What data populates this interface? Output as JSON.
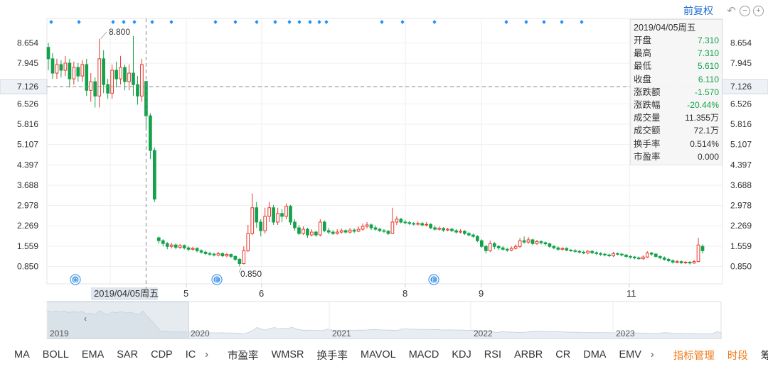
{
  "header": {
    "restore_right_label": "前复权"
  },
  "info_panel": {
    "date": "2019/04/05周五",
    "rows": [
      {
        "key": "开盘",
        "value": "7.310",
        "color": "green"
      },
      {
        "key": "最高",
        "value": "7.310",
        "color": "green"
      },
      {
        "key": "最低",
        "value": "5.610",
        "color": "green"
      },
      {
        "key": "收盘",
        "value": "6.110",
        "color": "green"
      },
      {
        "key": "涨跌额",
        "value": "-1.570",
        "color": "green"
      },
      {
        "key": "涨跌幅",
        "value": "-20.44%",
        "color": "green"
      },
      {
        "key": "成交量",
        "value": "11.355万",
        "color": "normal"
      },
      {
        "key": "成交额",
        "value": "72.1万",
        "color": "normal"
      },
      {
        "key": "换手率",
        "value": "0.514%",
        "color": "normal"
      },
      {
        "key": "市盈率",
        "value": "0.000",
        "color": "normal"
      }
    ]
  },
  "tabs": {
    "left": [
      "MA",
      "BOLL",
      "EMA",
      "SAR",
      "CDP",
      "IC"
    ],
    "right": [
      "市盈率",
      "WMSR",
      "换手率",
      "MAVOL",
      "MACD",
      "KDJ",
      "RSI",
      "ARBR",
      "CR",
      "DMA",
      "EMV"
    ],
    "manage_label": "指标管理",
    "timeshare_label": "时段",
    "chips_label": "筹码"
  },
  "colors": {
    "up": "#e8372c",
    "down": "#13a24b",
    "event_marker": "#1e90ff",
    "crosshair": "#888888"
  },
  "chart_data": {
    "type": "candlestick",
    "y_ticks": [
      "8.654",
      "7.945",
      "7.126",
      "6.526",
      "5.816",
      "5.107",
      "4.397",
      "3.688",
      "2.978",
      "2.269",
      "1.559",
      "0.850"
    ],
    "crosshair_value": "7.126",
    "x_tick_labels": [
      "5",
      "6",
      "8",
      "9",
      "11"
    ],
    "crosshair_date": "2019/04/05周五",
    "annotations": {
      "max_label": "8.800",
      "min_label": "0.850"
    },
    "event_badges": [
      "Q",
      "E",
      "E"
    ],
    "navigator_years": [
      "2019",
      "2020",
      "2021",
      "2022",
      "2023"
    ],
    "ylim": [
      0.85,
      8.654
    ],
    "series": [
      {
        "o": 8.5,
        "c": 8.1,
        "h": 8.654,
        "l": 7.7
      },
      {
        "o": 8.1,
        "c": 7.6,
        "h": 8.3,
        "l": 7.4
      },
      {
        "o": 7.6,
        "c": 7.9,
        "h": 8.1,
        "l": 7.4
      },
      {
        "o": 7.9,
        "c": 7.7,
        "h": 8.05,
        "l": 7.45
      },
      {
        "o": 7.7,
        "c": 7.95,
        "h": 8.2,
        "l": 7.5
      },
      {
        "o": 7.95,
        "c": 7.4,
        "h": 8.1,
        "l": 7.1
      },
      {
        "o": 7.4,
        "c": 7.8,
        "h": 8.0,
        "l": 7.2
      },
      {
        "o": 7.8,
        "c": 7.5,
        "h": 7.95,
        "l": 7.3
      },
      {
        "o": 7.5,
        "c": 7.9,
        "h": 8.05,
        "l": 7.3
      },
      {
        "o": 7.9,
        "c": 7.0,
        "h": 8.1,
        "l": 6.8
      },
      {
        "o": 7.0,
        "c": 7.3,
        "h": 7.6,
        "l": 6.6
      },
      {
        "o": 7.3,
        "c": 6.8,
        "h": 7.45,
        "l": 6.4
      },
      {
        "o": 6.8,
        "c": 8.1,
        "h": 8.8,
        "l": 6.4
      },
      {
        "o": 8.1,
        "c": 7.2,
        "h": 8.4,
        "l": 6.9
      },
      {
        "o": 7.2,
        "c": 6.9,
        "h": 7.4,
        "l": 6.7
      },
      {
        "o": 6.9,
        "c": 7.7,
        "h": 7.9,
        "l": 6.7
      },
      {
        "o": 7.7,
        "c": 7.4,
        "h": 8.0,
        "l": 7.1
      },
      {
        "o": 7.4,
        "c": 7.8,
        "h": 8.2,
        "l": 7.2
      },
      {
        "o": 7.8,
        "c": 7.3,
        "h": 7.9,
        "l": 7.0
      },
      {
        "o": 7.3,
        "c": 7.6,
        "h": 7.9,
        "l": 7.0
      },
      {
        "o": 7.6,
        "c": 7.2,
        "h": 8.9,
        "l": 6.8
      },
      {
        "o": 7.2,
        "c": 6.8,
        "h": 7.5,
        "l": 6.5
      },
      {
        "o": 6.8,
        "c": 7.9,
        "h": 8.1,
        "l": 6.6
      },
      {
        "o": 7.31,
        "c": 6.11,
        "h": 7.31,
        "l": 5.61
      },
      {
        "o": 6.11,
        "c": 4.9,
        "h": 6.2,
        "l": 4.6
      },
      {
        "o": 4.9,
        "c": 3.2,
        "h": 5.0,
        "l": 3.1
      },
      {
        "o": 1.85,
        "c": 1.75,
        "h": 1.9,
        "l": 1.65
      },
      {
        "o": 1.75,
        "c": 1.65,
        "h": 1.8,
        "l": 1.55
      },
      {
        "o": 1.65,
        "c": 1.55,
        "h": 1.7,
        "l": 1.45
      },
      {
        "o": 1.55,
        "c": 1.6,
        "h": 1.68,
        "l": 1.48
      },
      {
        "o": 1.6,
        "c": 1.52,
        "h": 1.66,
        "l": 1.45
      },
      {
        "o": 1.52,
        "c": 1.58,
        "h": 1.64,
        "l": 1.46
      },
      {
        "o": 1.58,
        "c": 1.5,
        "h": 1.62,
        "l": 1.44
      },
      {
        "o": 1.5,
        "c": 1.45,
        "h": 1.56,
        "l": 1.38
      },
      {
        "o": 1.45,
        "c": 1.48,
        "h": 1.54,
        "l": 1.4
      },
      {
        "o": 1.48,
        "c": 1.4,
        "h": 1.52,
        "l": 1.34
      },
      {
        "o": 1.4,
        "c": 1.35,
        "h": 1.45,
        "l": 1.3
      },
      {
        "o": 1.35,
        "c": 1.3,
        "h": 1.4,
        "l": 1.25
      },
      {
        "o": 1.3,
        "c": 1.28,
        "h": 1.36,
        "l": 1.22
      },
      {
        "o": 1.28,
        "c": 1.25,
        "h": 1.33,
        "l": 1.2
      },
      {
        "o": 1.25,
        "c": 1.3,
        "h": 1.36,
        "l": 1.2
      },
      {
        "o": 1.3,
        "c": 1.22,
        "h": 1.34,
        "l": 1.18
      },
      {
        "o": 1.22,
        "c": 1.27,
        "h": 1.32,
        "l": 1.17
      },
      {
        "o": 1.27,
        "c": 1.2,
        "h": 1.3,
        "l": 1.14
      },
      {
        "o": 1.2,
        "c": 1.1,
        "h": 1.24,
        "l": 1.04
      },
      {
        "o": 1.1,
        "c": 0.95,
        "h": 1.14,
        "l": 0.85
      },
      {
        "o": 0.95,
        "c": 1.4,
        "h": 1.55,
        "l": 0.92
      },
      {
        "o": 1.4,
        "c": 2.0,
        "h": 2.3,
        "l": 1.35
      },
      {
        "o": 2.0,
        "c": 2.9,
        "h": 3.4,
        "l": 1.95
      },
      {
        "o": 2.9,
        "c": 2.4,
        "h": 3.1,
        "l": 2.2
      },
      {
        "o": 2.4,
        "c": 2.1,
        "h": 2.5,
        "l": 1.9
      },
      {
        "o": 2.1,
        "c": 2.6,
        "h": 2.9,
        "l": 2.0
      },
      {
        "o": 2.6,
        "c": 2.9,
        "h": 3.1,
        "l": 2.4
      },
      {
        "o": 2.9,
        "c": 2.4,
        "h": 3.0,
        "l": 2.3
      },
      {
        "o": 2.4,
        "c": 2.7,
        "h": 2.9,
        "l": 2.3
      },
      {
        "o": 2.7,
        "c": 2.6,
        "h": 2.85,
        "l": 2.4
      },
      {
        "o": 2.6,
        "c": 2.95,
        "h": 3.05,
        "l": 2.5
      },
      {
        "o": 2.95,
        "c": 2.4,
        "h": 3.0,
        "l": 2.3
      },
      {
        "o": 2.4,
        "c": 2.2,
        "h": 2.5,
        "l": 2.1
      },
      {
        "o": 2.2,
        "c": 2.0,
        "h": 2.3,
        "l": 1.95
      },
      {
        "o": 2.0,
        "c": 2.15,
        "h": 2.25,
        "l": 1.95
      },
      {
        "o": 2.15,
        "c": 1.95,
        "h": 2.2,
        "l": 1.85
      },
      {
        "o": 1.95,
        "c": 2.05,
        "h": 2.15,
        "l": 1.9
      },
      {
        "o": 2.05,
        "c": 1.95,
        "h": 2.1,
        "l": 1.88
      },
      {
        "o": 1.95,
        "c": 2.4,
        "h": 2.5,
        "l": 1.9
      },
      {
        "o": 2.4,
        "c": 2.1,
        "h": 2.45,
        "l": 2.05
      },
      {
        "o": 2.1,
        "c": 2.05,
        "h": 2.2,
        "l": 1.98
      },
      {
        "o": 2.05,
        "c": 2.0,
        "h": 2.12,
        "l": 1.95
      },
      {
        "o": 2.0,
        "c": 2.05,
        "h": 2.15,
        "l": 1.96
      },
      {
        "o": 2.05,
        "c": 2.1,
        "h": 2.18,
        "l": 2.0
      },
      {
        "o": 2.1,
        "c": 2.05,
        "h": 2.15,
        "l": 2.0
      },
      {
        "o": 2.05,
        "c": 2.12,
        "h": 2.2,
        "l": 2.0
      },
      {
        "o": 2.12,
        "c": 2.08,
        "h": 2.18,
        "l": 2.02
      },
      {
        "o": 2.08,
        "c": 2.15,
        "h": 2.25,
        "l": 2.05
      },
      {
        "o": 2.15,
        "c": 2.25,
        "h": 2.35,
        "l": 2.1
      },
      {
        "o": 2.25,
        "c": 2.3,
        "h": 2.4,
        "l": 2.18
      },
      {
        "o": 2.3,
        "c": 2.2,
        "h": 2.35,
        "l": 2.12
      },
      {
        "o": 2.2,
        "c": 2.15,
        "h": 2.28,
        "l": 2.1
      },
      {
        "o": 2.15,
        "c": 2.1,
        "h": 2.2,
        "l": 2.05
      },
      {
        "o": 2.1,
        "c": 2.08,
        "h": 2.15,
        "l": 2.02
      },
      {
        "o": 2.08,
        "c": 2.0,
        "h": 2.12,
        "l": 1.95
      },
      {
        "o": 2.0,
        "c": 2.4,
        "h": 2.9,
        "l": 1.98
      },
      {
        "o": 2.4,
        "c": 2.5,
        "h": 2.6,
        "l": 2.3
      },
      {
        "o": 2.5,
        "c": 2.4,
        "h": 2.55,
        "l": 2.35
      },
      {
        "o": 2.4,
        "c": 2.38,
        "h": 2.48,
        "l": 2.32
      },
      {
        "o": 2.38,
        "c": 2.35,
        "h": 2.44,
        "l": 2.3
      },
      {
        "o": 2.35,
        "c": 2.33,
        "h": 2.4,
        "l": 2.28
      },
      {
        "o": 2.33,
        "c": 2.35,
        "h": 2.42,
        "l": 2.28
      },
      {
        "o": 2.35,
        "c": 2.3,
        "h": 2.4,
        "l": 2.25
      },
      {
        "o": 2.3,
        "c": 2.32,
        "h": 2.4,
        "l": 2.25
      },
      {
        "o": 2.32,
        "c": 2.2,
        "h": 2.36,
        "l": 2.15
      },
      {
        "o": 2.2,
        "c": 2.15,
        "h": 2.28,
        "l": 2.1
      },
      {
        "o": 2.15,
        "c": 2.18,
        "h": 2.25,
        "l": 2.1
      },
      {
        "o": 2.18,
        "c": 2.12,
        "h": 2.22,
        "l": 2.06
      },
      {
        "o": 2.12,
        "c": 2.15,
        "h": 2.2,
        "l": 2.08
      },
      {
        "o": 2.15,
        "c": 2.1,
        "h": 2.2,
        "l": 2.05
      },
      {
        "o": 2.1,
        "c": 2.05,
        "h": 2.15,
        "l": 2.0
      },
      {
        "o": 2.05,
        "c": 2.08,
        "h": 2.15,
        "l": 2.0
      },
      {
        "o": 2.08,
        "c": 2.0,
        "h": 2.12,
        "l": 1.95
      },
      {
        "o": 2.0,
        "c": 1.95,
        "h": 2.05,
        "l": 1.9
      },
      {
        "o": 1.95,
        "c": 1.9,
        "h": 2.0,
        "l": 1.85
      },
      {
        "o": 1.9,
        "c": 1.75,
        "h": 1.94,
        "l": 1.7
      },
      {
        "o": 1.75,
        "c": 1.55,
        "h": 1.8,
        "l": 1.5
      },
      {
        "o": 1.55,
        "c": 1.4,
        "h": 1.6,
        "l": 1.3
      },
      {
        "o": 1.4,
        "c": 1.65,
        "h": 1.75,
        "l": 1.35
      },
      {
        "o": 1.65,
        "c": 1.55,
        "h": 1.7,
        "l": 1.45
      },
      {
        "o": 1.55,
        "c": 1.5,
        "h": 1.6,
        "l": 1.42
      },
      {
        "o": 1.5,
        "c": 1.45,
        "h": 1.56,
        "l": 1.4
      },
      {
        "o": 1.45,
        "c": 1.42,
        "h": 1.5,
        "l": 1.36
      },
      {
        "o": 1.42,
        "c": 1.48,
        "h": 1.55,
        "l": 1.38
      },
      {
        "o": 1.48,
        "c": 1.55,
        "h": 1.62,
        "l": 1.44
      },
      {
        "o": 1.55,
        "c": 1.75,
        "h": 1.85,
        "l": 1.5
      },
      {
        "o": 1.75,
        "c": 1.7,
        "h": 1.9,
        "l": 1.65
      },
      {
        "o": 1.7,
        "c": 1.78,
        "h": 1.88,
        "l": 1.64
      },
      {
        "o": 1.78,
        "c": 1.65,
        "h": 1.82,
        "l": 1.6
      },
      {
        "o": 1.65,
        "c": 1.72,
        "h": 1.78,
        "l": 1.6
      },
      {
        "o": 1.72,
        "c": 1.68,
        "h": 1.76,
        "l": 1.62
      },
      {
        "o": 1.68,
        "c": 1.64,
        "h": 1.72,
        "l": 1.58
      },
      {
        "o": 1.64,
        "c": 1.55,
        "h": 1.68,
        "l": 1.5
      },
      {
        "o": 1.55,
        "c": 1.5,
        "h": 1.6,
        "l": 1.45
      },
      {
        "o": 1.5,
        "c": 1.45,
        "h": 1.55,
        "l": 1.4
      },
      {
        "o": 1.45,
        "c": 1.48,
        "h": 1.52,
        "l": 1.4
      },
      {
        "o": 1.48,
        "c": 1.42,
        "h": 1.52,
        "l": 1.38
      },
      {
        "o": 1.42,
        "c": 1.4,
        "h": 1.46,
        "l": 1.36
      },
      {
        "o": 1.4,
        "c": 1.38,
        "h": 1.45,
        "l": 1.33
      },
      {
        "o": 1.38,
        "c": 1.35,
        "h": 1.42,
        "l": 1.3
      },
      {
        "o": 1.35,
        "c": 1.32,
        "h": 1.4,
        "l": 1.28
      },
      {
        "o": 1.32,
        "c": 1.38,
        "h": 1.42,
        "l": 1.28
      },
      {
        "o": 1.38,
        "c": 1.33,
        "h": 1.42,
        "l": 1.28
      },
      {
        "o": 1.33,
        "c": 1.3,
        "h": 1.37,
        "l": 1.25
      },
      {
        "o": 1.3,
        "c": 1.28,
        "h": 1.35,
        "l": 1.22
      },
      {
        "o": 1.28,
        "c": 1.25,
        "h": 1.32,
        "l": 1.2
      },
      {
        "o": 1.25,
        "c": 1.22,
        "h": 1.3,
        "l": 1.18
      },
      {
        "o": 1.22,
        "c": 1.3,
        "h": 1.36,
        "l": 1.18
      },
      {
        "o": 1.3,
        "c": 1.28,
        "h": 1.34,
        "l": 1.24
      },
      {
        "o": 1.28,
        "c": 1.25,
        "h": 1.32,
        "l": 1.2
      },
      {
        "o": 1.25,
        "c": 1.2,
        "h": 1.28,
        "l": 1.15
      },
      {
        "o": 1.2,
        "c": 1.18,
        "h": 1.24,
        "l": 1.12
      },
      {
        "o": 1.18,
        "c": 1.15,
        "h": 1.22,
        "l": 1.1
      },
      {
        "o": 1.15,
        "c": 1.12,
        "h": 1.2,
        "l": 1.08
      },
      {
        "o": 1.12,
        "c": 1.18,
        "h": 1.24,
        "l": 1.08
      },
      {
        "o": 1.18,
        "c": 1.32,
        "h": 1.38,
        "l": 1.15
      },
      {
        "o": 1.32,
        "c": 1.28,
        "h": 1.36,
        "l": 1.22
      },
      {
        "o": 1.28,
        "c": 1.2,
        "h": 1.32,
        "l": 1.15
      },
      {
        "o": 1.2,
        "c": 1.15,
        "h": 1.24,
        "l": 1.1
      },
      {
        "o": 1.15,
        "c": 1.1,
        "h": 1.2,
        "l": 1.05
      },
      {
        "o": 1.1,
        "c": 1.05,
        "h": 1.15,
        "l": 1.0
      },
      {
        "o": 1.05,
        "c": 1.0,
        "h": 1.1,
        "l": 0.95
      },
      {
        "o": 1.0,
        "c": 1.02,
        "h": 1.08,
        "l": 0.96
      },
      {
        "o": 1.02,
        "c": 0.98,
        "h": 1.06,
        "l": 0.94
      },
      {
        "o": 0.98,
        "c": 1.0,
        "h": 1.04,
        "l": 0.94
      },
      {
        "o": 1.0,
        "c": 0.97,
        "h": 1.04,
        "l": 0.92
      },
      {
        "o": 0.97,
        "c": 1.02,
        "h": 1.08,
        "l": 0.94
      },
      {
        "o": 1.02,
        "c": 1.6,
        "h": 1.85,
        "l": 1.0
      },
      {
        "o": 1.55,
        "c": 1.4,
        "h": 1.62,
        "l": 1.3
      }
    ],
    "up_markers_count": 26,
    "navigator_window": [
      0,
      0.21
    ]
  }
}
